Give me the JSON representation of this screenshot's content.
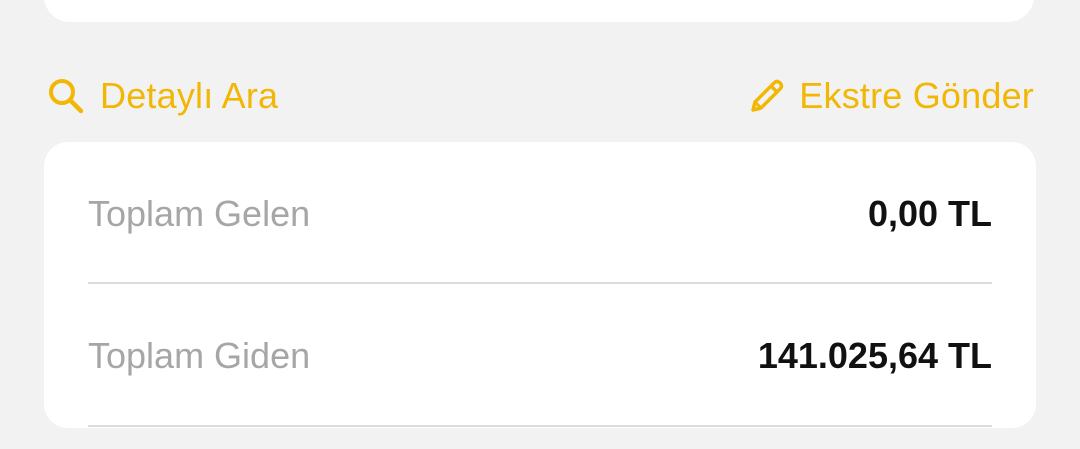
{
  "colors": {
    "accent": "#f2b705",
    "background": "#f2f2f2",
    "card": "#ffffff",
    "label": "#a6a6a6",
    "value": "#111111",
    "divider": "#dcdcdc"
  },
  "actions": {
    "search": {
      "icon": "search-icon",
      "label": "Detaylı Ara"
    },
    "statement": {
      "icon": "pencil-icon",
      "label": "Ekstre Gönder"
    }
  },
  "summary": {
    "rows": [
      {
        "label": "Toplam Gelen",
        "value": "0,00 TL"
      },
      {
        "label": "Toplam Giden",
        "value": "141.025,64 TL"
      }
    ]
  }
}
